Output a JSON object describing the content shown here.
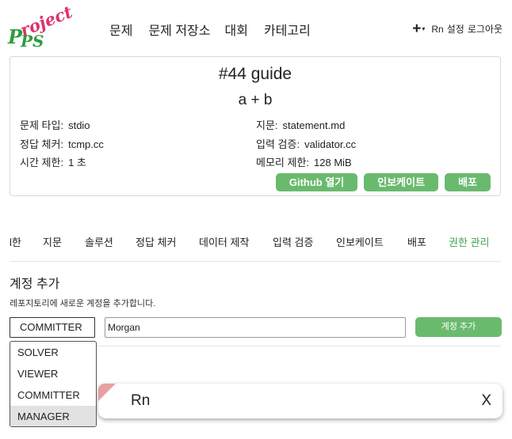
{
  "header": {
    "logo": {
      "letters": "P",
      "letters2": "PS",
      "word": "roject"
    },
    "nav": [
      "문제",
      "문제 저장소",
      "대회",
      "카테고리"
    ],
    "user": {
      "plus": "+",
      "caret": "▾",
      "name": "Rn",
      "settings": "설정",
      "logout": "로그아웃"
    }
  },
  "card": {
    "title": "#44 guide",
    "subtitle": "a + b",
    "left": [
      {
        "label": "문제 타입:",
        "value": "stdio"
      },
      {
        "label": "정답 체커:",
        "value": "tcmp.cc"
      },
      {
        "label": "시간 제한:",
        "value": "1 초"
      }
    ],
    "right": [
      {
        "label": "지문:",
        "value": "statement.md"
      },
      {
        "label": "입력 검증:",
        "value": "validator.cc"
      },
      {
        "label": "메모리 제한:",
        "value": "128 MiB"
      }
    ],
    "buttons": [
      "Github 열기",
      "인보케이트",
      "배포"
    ]
  },
  "tabs": [
    "l한",
    "지문",
    "솔루션",
    "정답 체커",
    "데이터 제작",
    "입력 검증",
    "인보케이트",
    "배포",
    "권한 관리"
  ],
  "section": {
    "title": "계정 추가",
    "desc": "레포지토리에 새로운 계정을 추가합니다.",
    "role_selected": "COMMITTER",
    "input_value": "Morgan",
    "add_button": "계정 추가",
    "dropdown": [
      "SOLVER",
      "VIEWER",
      "COMMITTER",
      "MANAGER"
    ]
  },
  "toast": {
    "name": "Rn",
    "close": "X"
  },
  "colors": {
    "accent": "#6aba6e",
    "active_tab": "#3fa447",
    "logo_pink": "#e0306a",
    "logo_green": "#2e9c3e"
  }
}
